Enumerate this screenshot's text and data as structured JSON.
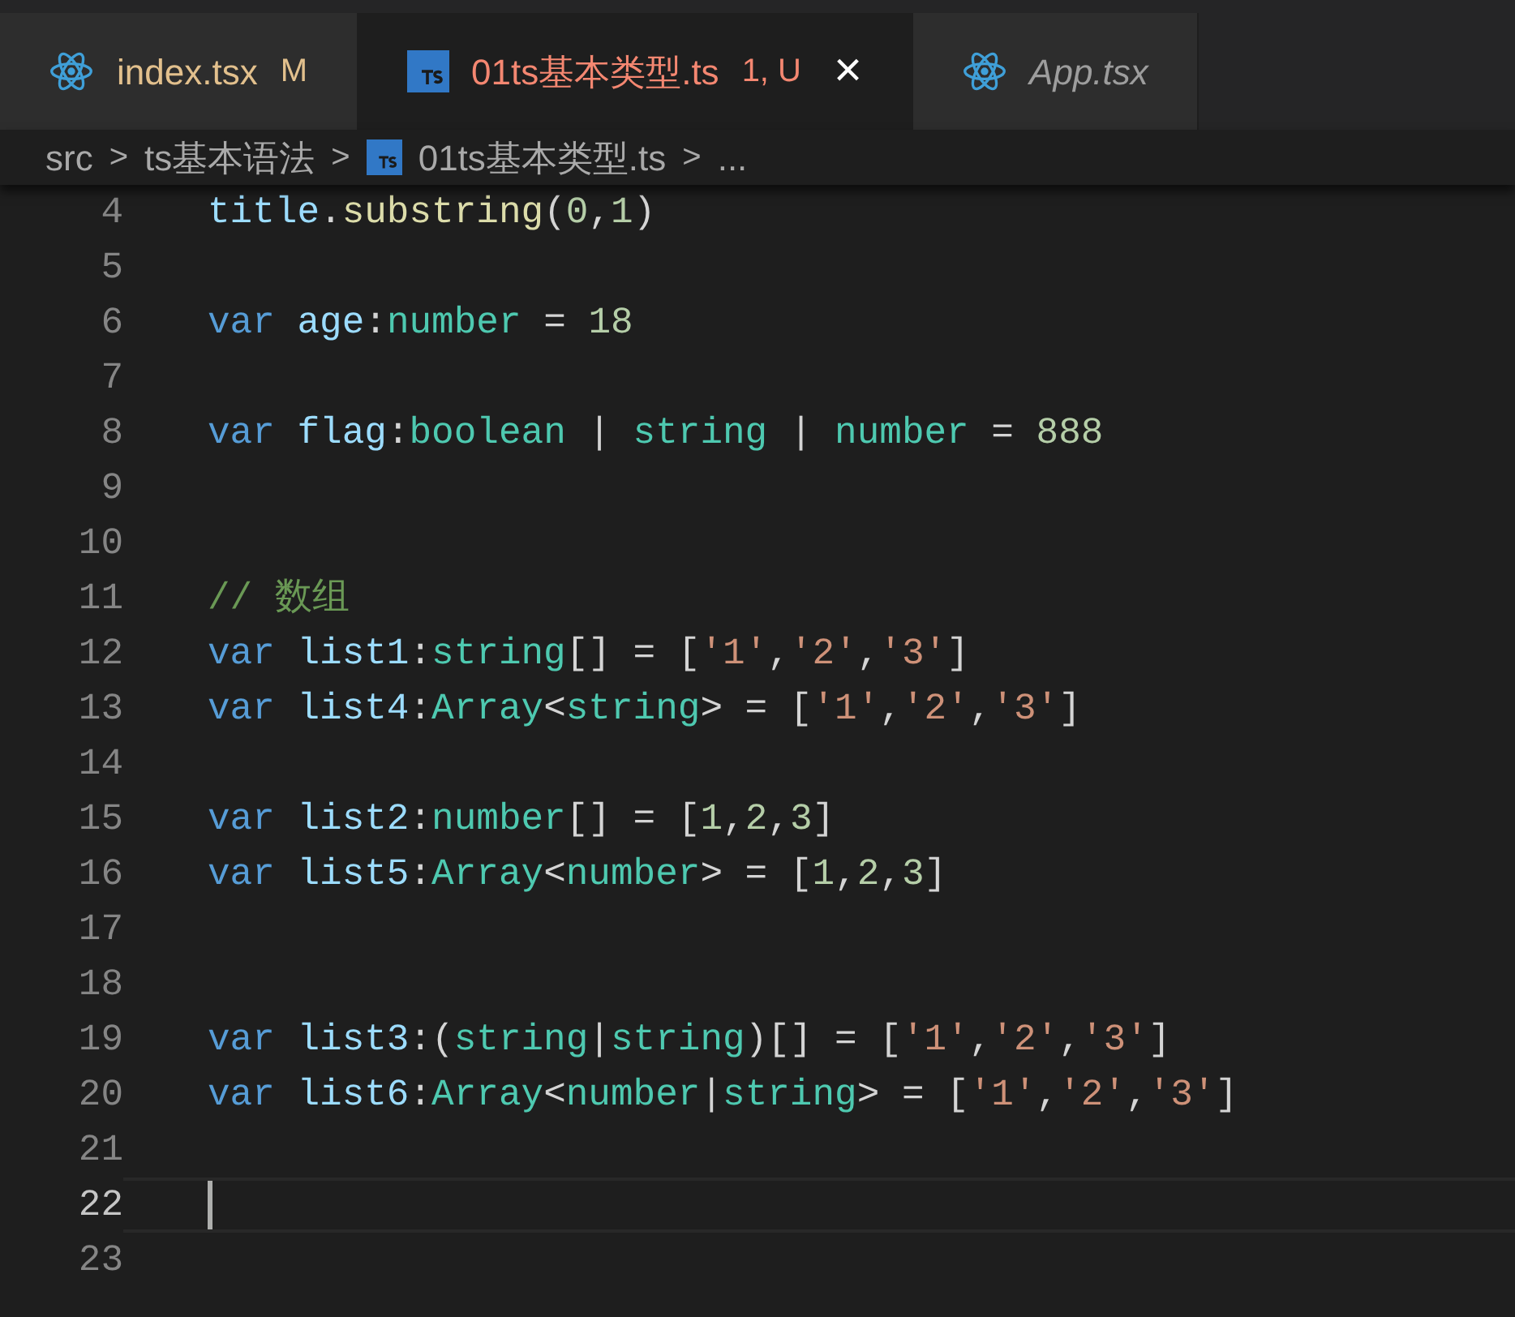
{
  "tabs": [
    {
      "label": "index.tsx",
      "status": {
        "text": "M",
        "color": "#e2c08d"
      },
      "kind": "react",
      "selected": false,
      "preview": false
    },
    {
      "label": "01ts基本类型.ts",
      "status": {
        "text": "1, U",
        "color": "#f48771"
      },
      "kind": "ts",
      "selected": true,
      "preview": false,
      "close": "×"
    },
    {
      "label": "App.tsx",
      "kind": "react",
      "selected": false,
      "preview": true
    }
  ],
  "breadcrumb": [
    {
      "label": "src"
    },
    {
      "label": "ts基本语法"
    },
    {
      "label": "01ts基本类型.ts",
      "kind": "ts"
    },
    {
      "label": "..."
    }
  ],
  "breadcrumb_separator": ">",
  "editor": {
    "lines": [
      {
        "number": "4",
        "current": false,
        "tokens": [
          {
            "kind": "variable",
            "text": "title"
          },
          {
            "kind": "punct",
            "text": "."
          },
          {
            "kind": "function",
            "text": "substring"
          },
          {
            "kind": "punct",
            "text": "("
          },
          {
            "kind": "number",
            "text": "0"
          },
          {
            "kind": "punct",
            "text": ","
          },
          {
            "kind": "number",
            "text": "1"
          },
          {
            "kind": "punct",
            "text": ")"
          }
        ]
      },
      {
        "number": "5",
        "current": false
      },
      {
        "number": "6",
        "current": false,
        "tokens": [
          {
            "kind": "keyword",
            "text": "var "
          },
          {
            "kind": "variable",
            "text": "age"
          },
          {
            "kind": "punct",
            "text": ":"
          },
          {
            "kind": "type",
            "text": "number"
          },
          {
            "kind": "punct",
            "text": " = "
          },
          {
            "kind": "number",
            "text": "18"
          }
        ]
      },
      {
        "number": "7",
        "current": false
      },
      {
        "number": "8",
        "current": false,
        "tokens": [
          {
            "kind": "keyword",
            "text": "var "
          },
          {
            "kind": "variable",
            "text": "flag"
          },
          {
            "kind": "punct",
            "text": ":"
          },
          {
            "kind": "type",
            "text": "boolean"
          },
          {
            "kind": "punct",
            "text": " | "
          },
          {
            "kind": "type",
            "text": "string"
          },
          {
            "kind": "punct",
            "text": " | "
          },
          {
            "kind": "type",
            "text": "number"
          },
          {
            "kind": "punct",
            "text": " = "
          },
          {
            "kind": "number",
            "text": "888"
          }
        ]
      },
      {
        "number": "9",
        "current": false
      },
      {
        "number": "10",
        "current": false
      },
      {
        "number": "11",
        "current": false,
        "tokens": [
          {
            "kind": "comment",
            "text": "// 数组"
          }
        ]
      },
      {
        "number": "12",
        "current": false,
        "tokens": [
          {
            "kind": "keyword",
            "text": "var "
          },
          {
            "kind": "variable",
            "text": "list1"
          },
          {
            "kind": "punct",
            "text": ":"
          },
          {
            "kind": "type",
            "text": "string"
          },
          {
            "kind": "punct",
            "text": "[] = ["
          },
          {
            "kind": "string",
            "text": "'1'"
          },
          {
            "kind": "punct",
            "text": ","
          },
          {
            "kind": "string",
            "text": "'2'"
          },
          {
            "kind": "punct",
            "text": ","
          },
          {
            "kind": "string",
            "text": "'3'"
          },
          {
            "kind": "punct",
            "text": "]"
          }
        ]
      },
      {
        "number": "13",
        "current": false,
        "tokens": [
          {
            "kind": "keyword",
            "text": "var "
          },
          {
            "kind": "variable",
            "text": "list4"
          },
          {
            "kind": "punct",
            "text": ":"
          },
          {
            "kind": "type",
            "text": "Array"
          },
          {
            "kind": "punct",
            "text": "<"
          },
          {
            "kind": "type",
            "text": "string"
          },
          {
            "kind": "punct",
            "text": "> = ["
          },
          {
            "kind": "string",
            "text": "'1'"
          },
          {
            "kind": "punct",
            "text": ","
          },
          {
            "kind": "string",
            "text": "'2'"
          },
          {
            "kind": "punct",
            "text": ","
          },
          {
            "kind": "string",
            "text": "'3'"
          },
          {
            "kind": "punct",
            "text": "]"
          }
        ]
      },
      {
        "number": "14",
        "current": false
      },
      {
        "number": "15",
        "current": false,
        "tokens": [
          {
            "kind": "keyword",
            "text": "var "
          },
          {
            "kind": "variable",
            "text": "list2"
          },
          {
            "kind": "punct",
            "text": ":"
          },
          {
            "kind": "type",
            "text": "number"
          },
          {
            "kind": "punct",
            "text": "[] = ["
          },
          {
            "kind": "number",
            "text": "1"
          },
          {
            "kind": "punct",
            "text": ","
          },
          {
            "kind": "number",
            "text": "2"
          },
          {
            "kind": "punct",
            "text": ","
          },
          {
            "kind": "number",
            "text": "3"
          },
          {
            "kind": "punct",
            "text": "]"
          }
        ]
      },
      {
        "number": "16",
        "current": false,
        "tokens": [
          {
            "kind": "keyword",
            "text": "var "
          },
          {
            "kind": "variable",
            "text": "list5"
          },
          {
            "kind": "punct",
            "text": ":"
          },
          {
            "kind": "type",
            "text": "Array"
          },
          {
            "kind": "punct",
            "text": "<"
          },
          {
            "kind": "type",
            "text": "number"
          },
          {
            "kind": "punct",
            "text": "> = ["
          },
          {
            "kind": "number",
            "text": "1"
          },
          {
            "kind": "punct",
            "text": ","
          },
          {
            "kind": "number",
            "text": "2"
          },
          {
            "kind": "punct",
            "text": ","
          },
          {
            "kind": "number",
            "text": "3"
          },
          {
            "kind": "punct",
            "text": "]"
          }
        ]
      },
      {
        "number": "17",
        "current": false
      },
      {
        "number": "18",
        "current": false
      },
      {
        "number": "19",
        "current": false,
        "tokens": [
          {
            "kind": "keyword",
            "text": "var "
          },
          {
            "kind": "variable",
            "text": "list3"
          },
          {
            "kind": "punct",
            "text": ":("
          },
          {
            "kind": "type",
            "text": "string"
          },
          {
            "kind": "punct",
            "text": "|"
          },
          {
            "kind": "type",
            "text": "string"
          },
          {
            "kind": "punct",
            "text": ")[] = ["
          },
          {
            "kind": "string",
            "text": "'1'"
          },
          {
            "kind": "punct",
            "text": ","
          },
          {
            "kind": "string",
            "text": "'2'"
          },
          {
            "kind": "punct",
            "text": ","
          },
          {
            "kind": "string",
            "text": "'3'"
          },
          {
            "kind": "punct",
            "text": "]"
          }
        ]
      },
      {
        "number": "20",
        "current": false,
        "tokens": [
          {
            "kind": "keyword",
            "text": "var "
          },
          {
            "kind": "variable",
            "text": "list6"
          },
          {
            "kind": "punct",
            "text": ":"
          },
          {
            "kind": "type",
            "text": "Array"
          },
          {
            "kind": "punct",
            "text": "<"
          },
          {
            "kind": "type",
            "text": "number"
          },
          {
            "kind": "punct",
            "text": "|"
          },
          {
            "kind": "type",
            "text": "string"
          },
          {
            "kind": "punct",
            "text": "> = ["
          },
          {
            "kind": "string",
            "text": "'1'"
          },
          {
            "kind": "punct",
            "text": ","
          },
          {
            "kind": "string",
            "text": "'2'"
          },
          {
            "kind": "punct",
            "text": ","
          },
          {
            "kind": "string",
            "text": "'3'"
          },
          {
            "kind": "punct",
            "text": "]"
          }
        ]
      },
      {
        "number": "21",
        "current": false
      },
      {
        "number": "22",
        "current": true
      },
      {
        "number": "23",
        "current": false
      }
    ]
  }
}
